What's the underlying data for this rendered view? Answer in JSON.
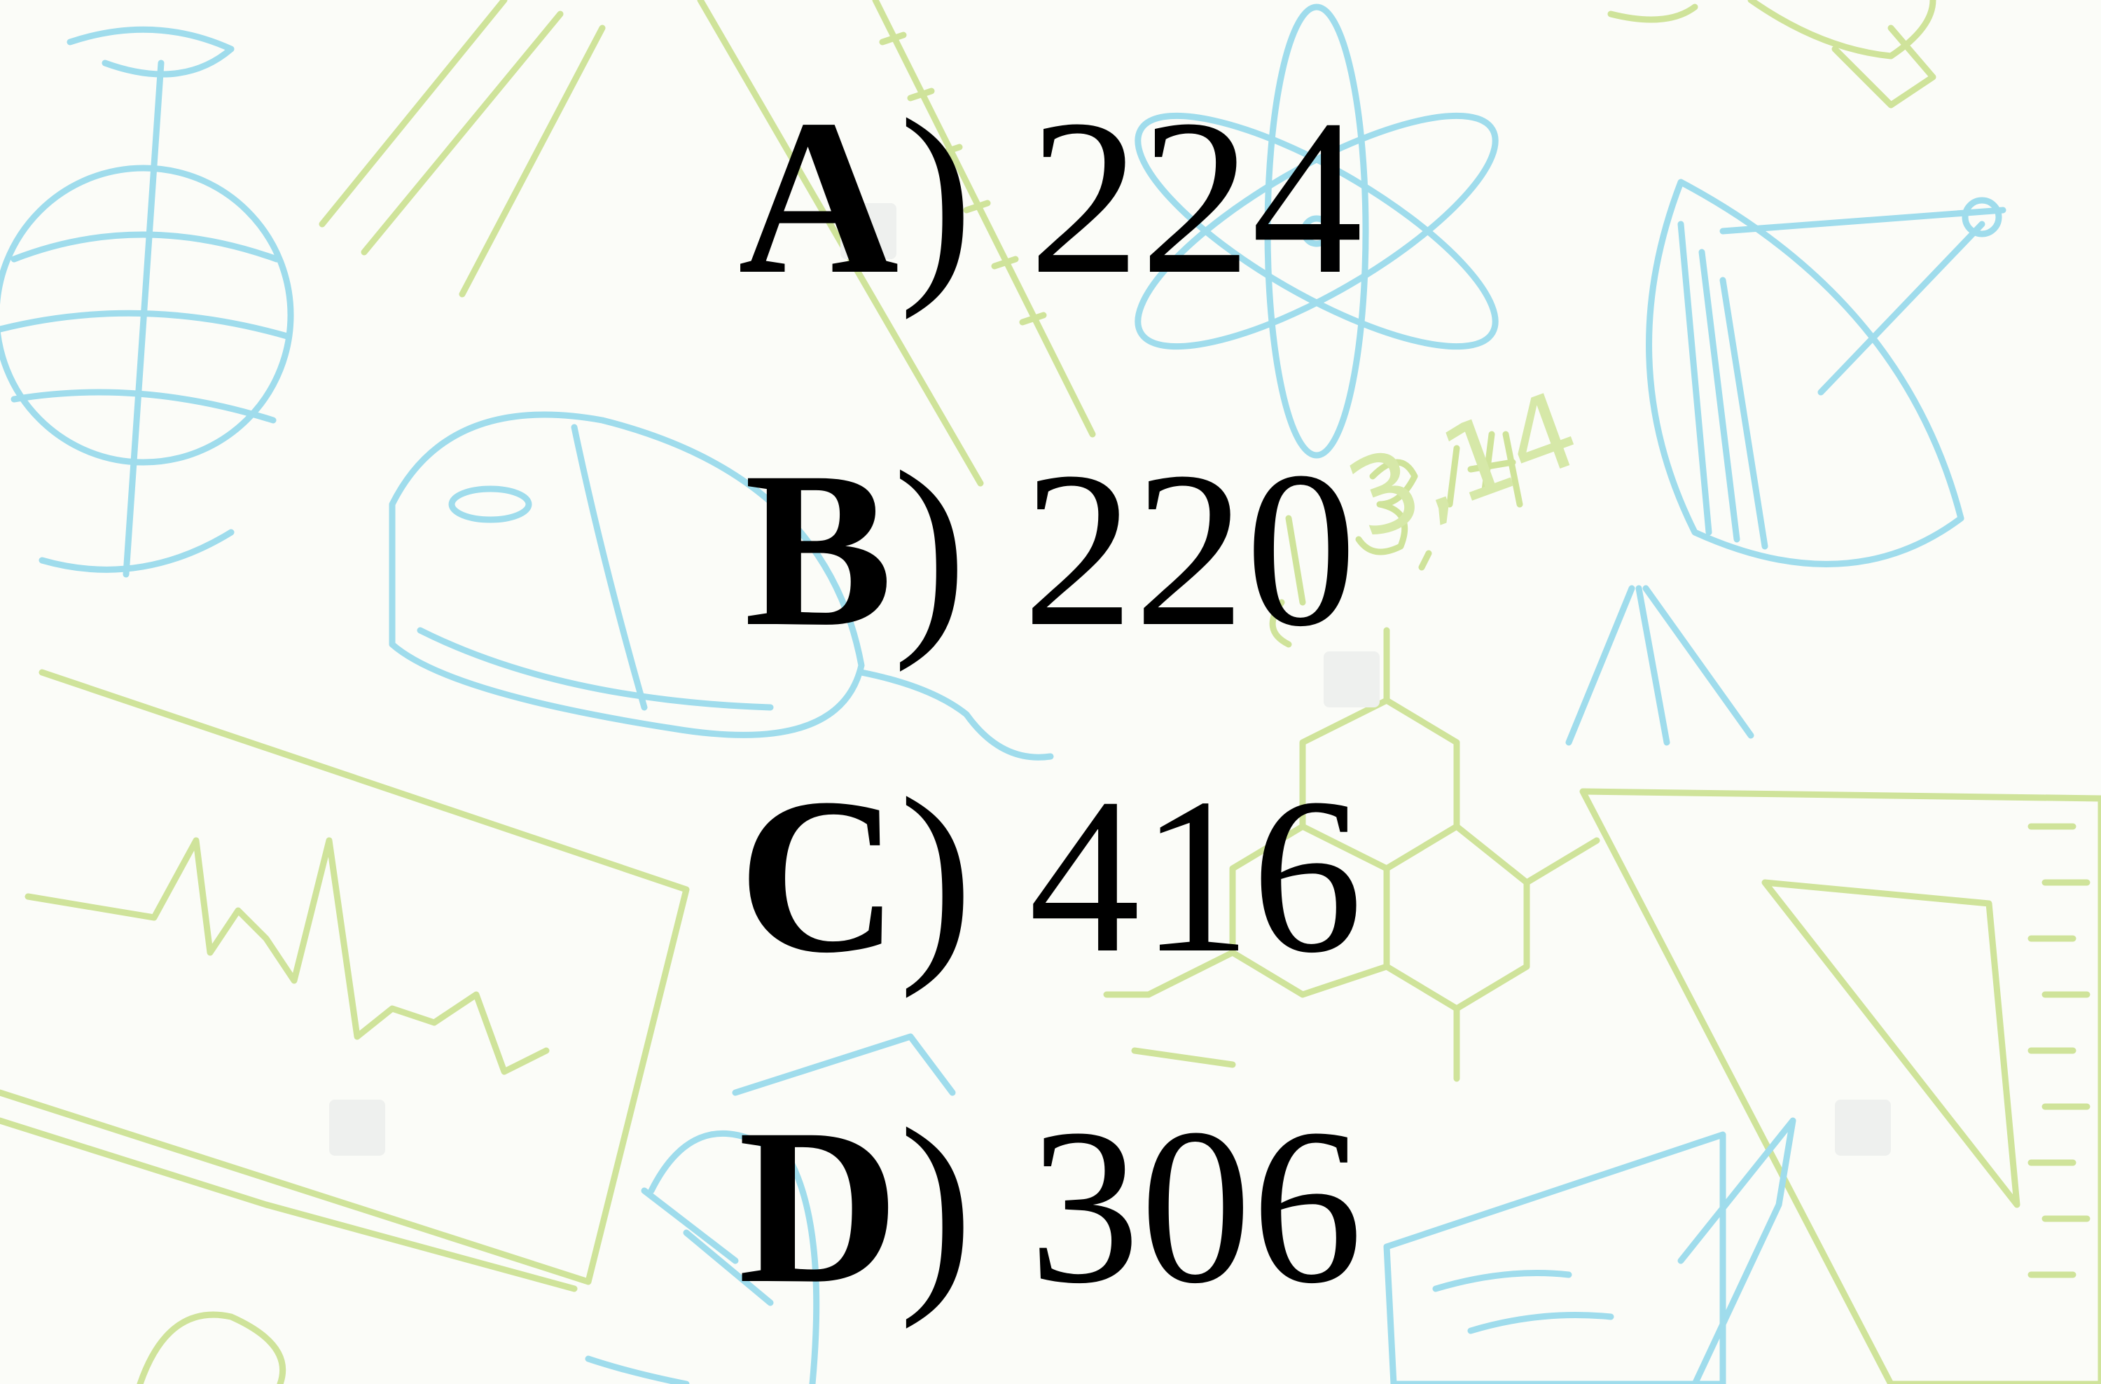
{
  "answer_options": [
    {
      "letter": "A",
      "separator": ")",
      "value": "224"
    },
    {
      "letter": "B",
      "separator": ")",
      "value": "220"
    },
    {
      "letter": "C",
      "separator": ")",
      "value": "416"
    },
    {
      "letter": "D",
      "separator": ")",
      "value": "306"
    }
  ],
  "background": {
    "style": "hand-drawn science doodles",
    "doodle_text": "3,14",
    "colors": {
      "blue": "#9fdcec",
      "green": "#cfe39a",
      "paper": "#fbfcf8",
      "text": "#000000"
    },
    "icons": [
      "globe-icon",
      "computer-mouse-icon",
      "atom-icon",
      "satellite-dish-icon",
      "triangle-ruler-icon",
      "ruler-icon",
      "molecule-icon",
      "heartbeat-chart-icon",
      "pencil-icon",
      "notepad-icon",
      "light-bulb-icon"
    ]
  }
}
